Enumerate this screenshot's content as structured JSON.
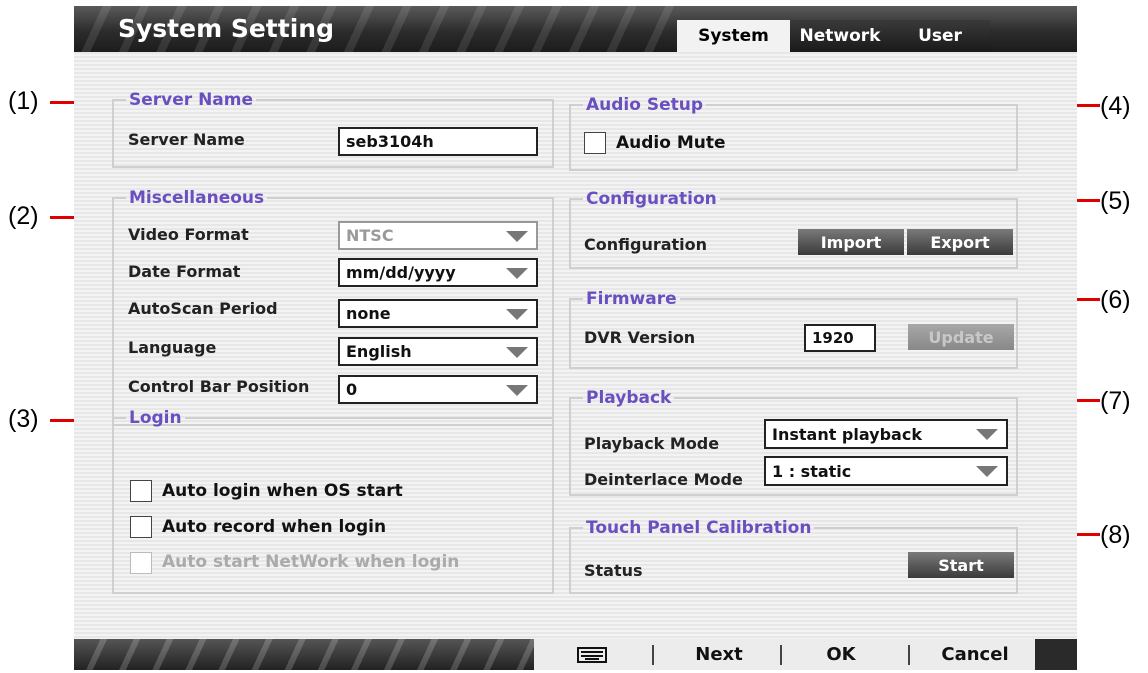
{
  "window": {
    "title": "System Setting"
  },
  "tabs": [
    {
      "label": "System",
      "active": true
    },
    {
      "label": "Network",
      "active": false
    },
    {
      "label": "User",
      "active": false
    }
  ],
  "callouts": [
    "(1)",
    "(2)",
    "(3)",
    "(4)",
    "(5)",
    "(6)",
    "(7)",
    "(8)"
  ],
  "server_name": {
    "legend": "Server Name",
    "label": "Server Name",
    "value": "seb3104h"
  },
  "misc": {
    "legend": "Miscellaneous",
    "video_format": {
      "label": "Video Format",
      "value": "NTSC",
      "disabled": true
    },
    "date_format": {
      "label": "Date Format",
      "value": "mm/dd/yyyy"
    },
    "autoscan": {
      "label": "AutoScan Period",
      "value": "none"
    },
    "language": {
      "label": "Language",
      "value": "English"
    },
    "control_bar": {
      "label": "Control Bar Position",
      "value": "0"
    }
  },
  "login": {
    "legend": "Login",
    "auto_login": {
      "label": "Auto login when OS start",
      "checked": false
    },
    "auto_record": {
      "label": "Auto record when login",
      "checked": false
    },
    "auto_network": {
      "label": "Auto start NetWork when login",
      "checked": false,
      "disabled": true
    }
  },
  "audio": {
    "legend": "Audio Setup",
    "mute_label": "Audio Mute",
    "muted": false
  },
  "configuration": {
    "legend": "Configuration",
    "label": "Configuration",
    "import_label": "Import",
    "export_label": "Export"
  },
  "firmware": {
    "legend": "Firmware",
    "label": "DVR Version",
    "version": "1920",
    "update_label": "Update"
  },
  "playback": {
    "legend": "Playback",
    "mode": {
      "label": "Playback Mode",
      "value": "Instant playback"
    },
    "deinterlace": {
      "label": "Deinterlace Mode",
      "value": "1 : static"
    }
  },
  "touch": {
    "legend": "Touch Panel Calibration",
    "label": "Status",
    "start_label": "Start"
  },
  "bottom": {
    "keyboard_icon": "keyboard-icon",
    "next_label": "Next",
    "ok_label": "OK",
    "cancel_label": "Cancel"
  },
  "colors": {
    "legend": "#6a4fc0",
    "callout_line": "#e00000",
    "title_bar": "#2c2c2c"
  }
}
